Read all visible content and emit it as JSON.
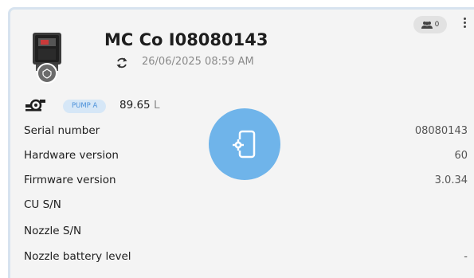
{
  "device": {
    "name": "MC Co I08080143",
    "last_sync": "26/06/2025 08:59 AM",
    "icon": "fuel-controller-device-icon",
    "status_icon": "shield-check-icon"
  },
  "users_badge": {
    "icon": "users-icon",
    "count": "0"
  },
  "menu_icon": "kebab-menu-icon",
  "pump": {
    "icon": "pump-icon",
    "tag": "PUMP A",
    "value": "89.65",
    "unit": "L"
  },
  "details": [
    {
      "label": "Serial number",
      "value": "08080143"
    },
    {
      "label": "Hardware version",
      "value": "60"
    },
    {
      "label": "Firmware version",
      "value": "3.0.34"
    },
    {
      "label": "CU S/N",
      "value": ""
    },
    {
      "label": "Nozzle S/N",
      "value": ""
    },
    {
      "label": "Nozzle battery level",
      "value": "-"
    }
  ],
  "config_button": {
    "icon": "mobile-settings-icon"
  },
  "colors": {
    "card_bg": "#f4f4f4",
    "accent_blue": "#6fb4ea",
    "tag_bg": "#d6e7f7",
    "tag_text": "#4a90d9"
  }
}
